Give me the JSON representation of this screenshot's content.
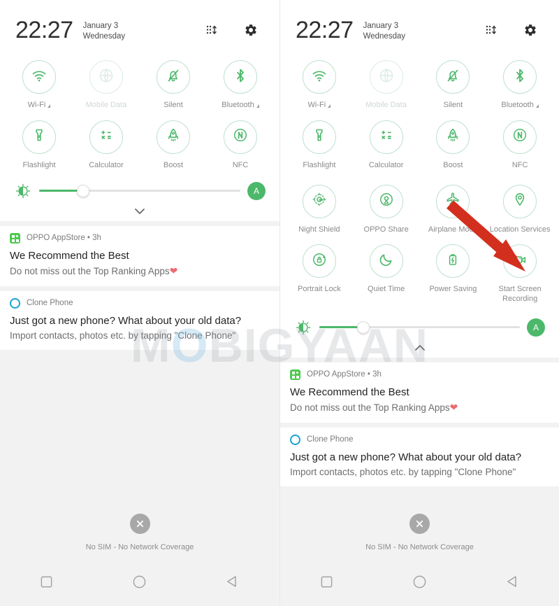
{
  "statusbar": {
    "time": "22:27",
    "date": "January 3",
    "weekday": "Wednesday",
    "edit_icon": "reorder-tiles-icon",
    "settings_icon": "gear-icon"
  },
  "colors": {
    "accent_green": "#4cb86a",
    "tile_outline": "#bfe0cd",
    "tile_icon": "#4cb86a",
    "disabled": "#cfd9d3",
    "arrow_red": "#d32f1e",
    "notif_heart": "#ec6b70",
    "panel_bg": "#f2f2f2"
  },
  "tiles_primary": [
    {
      "label": "Wi-Fi",
      "icon": "wifi-icon",
      "state": "on",
      "expandable": true
    },
    {
      "label": "Mobile Data",
      "icon": "globe-icon",
      "state": "off",
      "expandable": false
    },
    {
      "label": "Silent",
      "icon": "bell-muted-icon",
      "state": "on",
      "expandable": false
    },
    {
      "label": "Bluetooth",
      "icon": "bluetooth-icon",
      "state": "on",
      "expandable": true
    },
    {
      "label": "Flashlight",
      "icon": "flashlight-icon",
      "state": "on",
      "expandable": false
    },
    {
      "label": "Calculator",
      "icon": "calculator-icon",
      "state": "on",
      "expandable": false
    },
    {
      "label": "Boost",
      "icon": "rocket-icon",
      "state": "on",
      "expandable": false
    },
    {
      "label": "NFC",
      "icon": "nfc-icon",
      "state": "on",
      "expandable": false
    }
  ],
  "tiles_extra": [
    {
      "label": "Night Shield",
      "icon": "night-shield-icon",
      "state": "on",
      "expandable": false
    },
    {
      "label": "OPPO Share",
      "icon": "oppo-share-icon",
      "state": "on",
      "expandable": false
    },
    {
      "label": "Airplane Mode",
      "icon": "airplane-icon",
      "state": "on",
      "expandable": false
    },
    {
      "label": "Location Services",
      "icon": "location-pin-icon",
      "state": "on",
      "expandable": false
    },
    {
      "label": "Portrait Lock",
      "icon": "rotation-lock-icon",
      "state": "on",
      "expandable": false
    },
    {
      "label": "Quiet Time",
      "icon": "moon-icon",
      "state": "on",
      "expandable": false
    },
    {
      "label": "Power Saving",
      "icon": "battery-bolt-icon",
      "state": "on",
      "expandable": false
    },
    {
      "label": "Start Screen\nRecording",
      "icon": "video-camera-icon",
      "state": "on",
      "expandable": false
    }
  ],
  "brightness": {
    "icon": "brightness-icon",
    "value_percent": 22,
    "auto_label": "A",
    "auto_icon": "auto-brightness-icon"
  },
  "expand": {
    "left_chevron": "chevron-down-icon",
    "right_chevron": "chevron-up-icon"
  },
  "notifications": [
    {
      "app": "OPPO AppStore",
      "time": "3h",
      "separator": "•",
      "icon": "oppo-appstore-icon",
      "title": "We Recommend the Best",
      "body": "Do not miss out the Top Ranking Apps",
      "emoji": "❤"
    },
    {
      "app": "Clone Phone",
      "time": "",
      "separator": "",
      "icon": "clone-phone-icon",
      "title": "Just got a new phone? What about your old data?",
      "body": "Import contacts, photos etc. by tapping \"Clone Phone\"",
      "emoji": ""
    }
  ],
  "footer": {
    "clear_icon": "clear-all-icon",
    "sim_status": "No SIM - No Network Coverage"
  },
  "navbar": [
    {
      "name": "recents-button",
      "icon": "square-icon"
    },
    {
      "name": "home-button",
      "icon": "circle-icon"
    },
    {
      "name": "back-button",
      "icon": "triangle-left-icon"
    }
  ],
  "watermark": {
    "part1": "M",
    "part2": "O",
    "part3": "BIGYAAN"
  },
  "annotation": {
    "arrow": "red-arrow-pointing-to-start-screen-recording"
  }
}
